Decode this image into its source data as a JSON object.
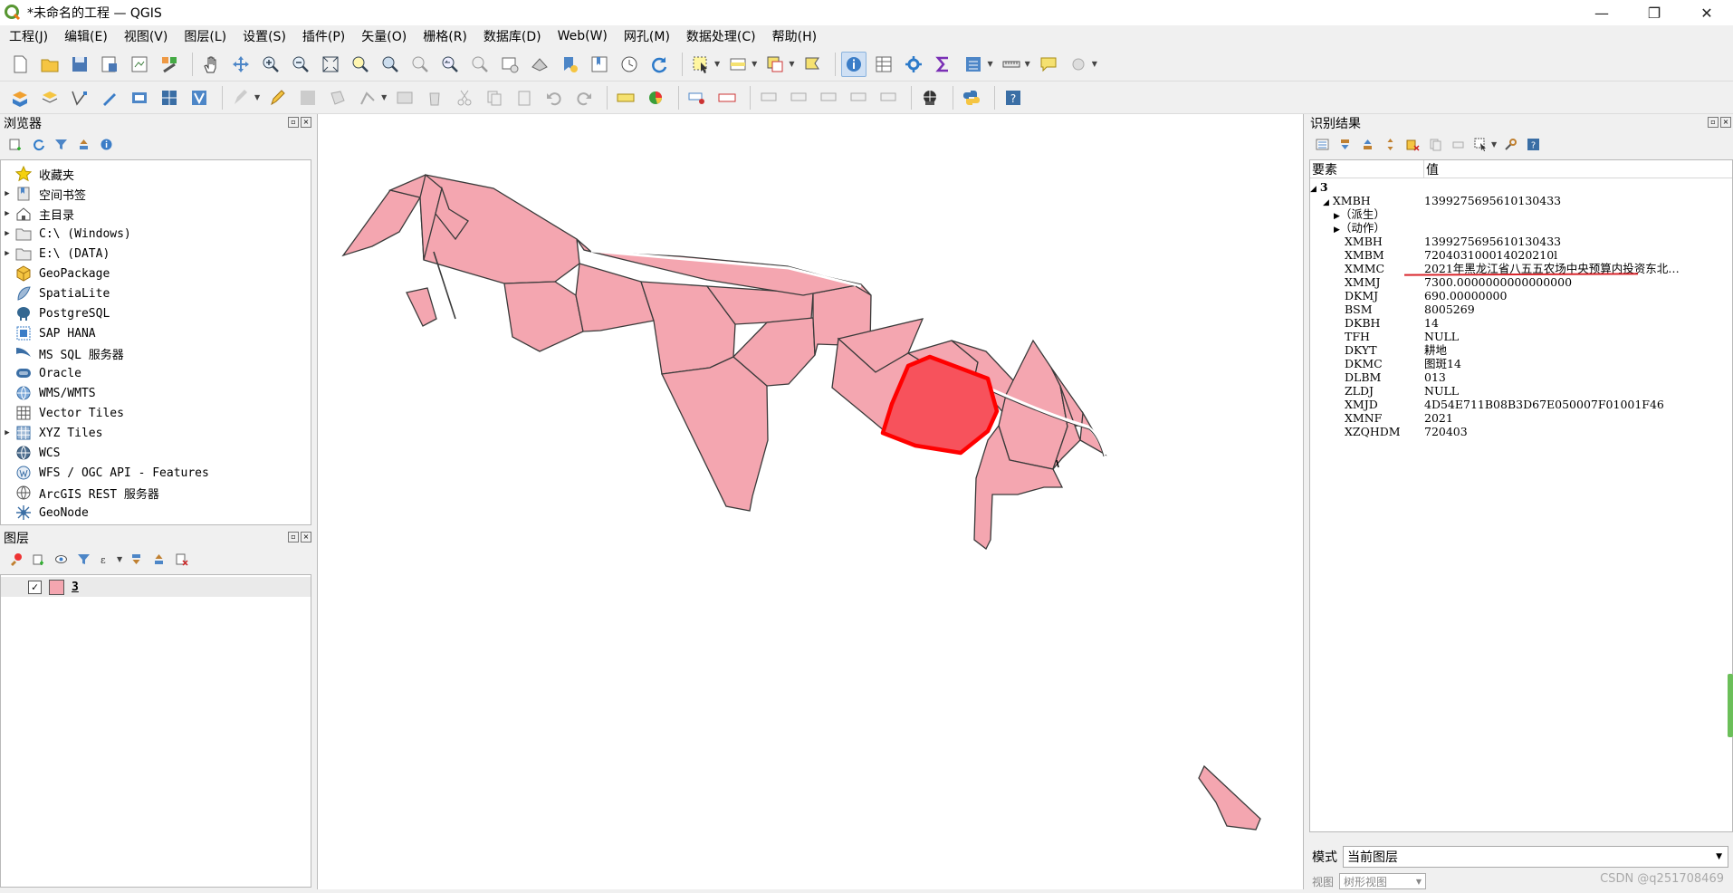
{
  "window": {
    "title": "*未命名的工程 — QGIS",
    "minimize": "—",
    "restore": "❐",
    "close": "✕"
  },
  "menu": [
    "工程(J)",
    "编辑(E)",
    "视图(V)",
    "图层(L)",
    "设置(S)",
    "插件(P)",
    "矢量(O)",
    "栅格(R)",
    "数据库(D)",
    "Web(W)",
    "网孔(M)",
    "数据处理(C)",
    "帮助(H)"
  ],
  "browser": {
    "title": "浏览器",
    "items": [
      {
        "label": "收藏夹",
        "icon": "star-icon",
        "expandable": false
      },
      {
        "label": "空间书签",
        "icon": "bookmark-icon",
        "expandable": true
      },
      {
        "label": "主目录",
        "icon": "home-icon",
        "expandable": true
      },
      {
        "label": "C:\\ (Windows)",
        "icon": "folder-icon",
        "expandable": true
      },
      {
        "label": "E:\\ (DATA)",
        "icon": "folder-icon",
        "expandable": true
      },
      {
        "label": "GeoPackage",
        "icon": "geopackage-icon",
        "expandable": false
      },
      {
        "label": "SpatiaLite",
        "icon": "spatialite-icon",
        "expandable": false
      },
      {
        "label": "PostgreSQL",
        "icon": "postgresql-icon",
        "expandable": false
      },
      {
        "label": "SAP HANA",
        "icon": "sap-hana-icon",
        "expandable": false
      },
      {
        "label": "MS SQL 服务器",
        "icon": "mssql-icon",
        "expandable": false
      },
      {
        "label": "Oracle",
        "icon": "oracle-icon",
        "expandable": false
      },
      {
        "label": "WMS/WMTS",
        "icon": "globe-icon",
        "expandable": false
      },
      {
        "label": "Vector Tiles",
        "icon": "vector-tiles-icon",
        "expandable": false
      },
      {
        "label": "XYZ Tiles",
        "icon": "xyz-tiles-icon",
        "expandable": true
      },
      {
        "label": "WCS",
        "icon": "globe-icon",
        "expandable": false
      },
      {
        "label": "WFS / OGC API - Features",
        "icon": "wfs-icon",
        "expandable": false
      },
      {
        "label": "ArcGIS REST 服务器",
        "icon": "arcgis-icon",
        "expandable": false
      },
      {
        "label": "GeoNode",
        "icon": "geonode-icon",
        "expandable": false
      }
    ]
  },
  "layers": {
    "title": "图层",
    "items": [
      {
        "label": "3",
        "checked": true,
        "color": "#f4a6b0"
      }
    ]
  },
  "identify": {
    "title": "识别结果",
    "col_feature": "要素",
    "col_value": "值",
    "layer": "3",
    "feature": {
      "key": "XMBH",
      "value": "1399275695610130433"
    },
    "groups": [
      "（派生）",
      "（动作）"
    ],
    "rows": [
      {
        "k": "XMBH",
        "v": "1399275695610130433"
      },
      {
        "k": "XMBM",
        "v": "720403100014020210l"
      },
      {
        "k": "XMMC",
        "v": "2021年黑龙江省八五五农场中央预算内投资东北…"
      },
      {
        "k": "XMMJ",
        "v": "7300.0000000000000000"
      },
      {
        "k": "DKMJ",
        "v": "690.00000000"
      },
      {
        "k": "BSM",
        "v": "8005269"
      },
      {
        "k": "DKBH",
        "v": "14"
      },
      {
        "k": "TFH",
        "v": "NULL"
      },
      {
        "k": "DKYT",
        "v": "耕地"
      },
      {
        "k": "DKMC",
        "v": "图斑14"
      },
      {
        "k": "DLBM",
        "v": "013"
      },
      {
        "k": "ZLDJ",
        "v": "NULL"
      },
      {
        "k": "XMJD",
        "v": "4D54E711B08B3D67E050007F01001F46"
      },
      {
        "k": "XMNF",
        "v": "2021"
      },
      {
        "k": "XZQHDM",
        "v": "720403"
      }
    ],
    "mode_label": "模式",
    "mode_value": "当前图层",
    "view_label": "视图",
    "view_value": "树形视图"
  },
  "colors": {
    "fill": "#f4a6b0",
    "selected_fill": "#f7525c",
    "selected_stroke": "#ff0000",
    "underline": "#d9262c"
  },
  "watermark": "CSDN @q251708469"
}
